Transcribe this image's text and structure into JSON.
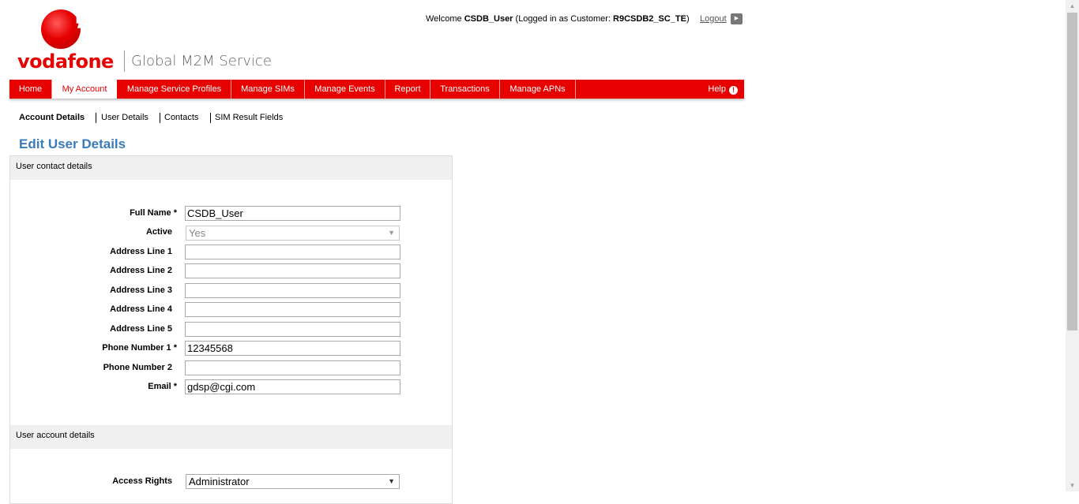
{
  "brand": {
    "logo_text": "vodafone",
    "subtitle": "Global M2M Service",
    "accent_color": "#e60000"
  },
  "session": {
    "welcome_prefix": "Welcome",
    "username": "CSDB_User",
    "logged_in_prefix": "(Logged in as Customer:",
    "customer": "R9CSDB2_SC_TE",
    "logged_in_suffix": ")",
    "logout_label": "Logout"
  },
  "nav": {
    "items": [
      {
        "label": "Home"
      },
      {
        "label": "My Account"
      },
      {
        "label": "Manage Service Profiles"
      },
      {
        "label": "Manage SIMs"
      },
      {
        "label": "Manage Events"
      },
      {
        "label": "Report"
      },
      {
        "label": "Transactions"
      },
      {
        "label": "Manage APNs"
      }
    ],
    "help_label": "Help"
  },
  "subnav": {
    "items": [
      {
        "label": "Account Details"
      },
      {
        "label": "User Details"
      },
      {
        "label": "Contacts"
      },
      {
        "label": "SIM Result Fields"
      }
    ]
  },
  "page_title": "Edit User Details",
  "contact_section": {
    "title": "User contact details",
    "fields": {
      "full_name": {
        "label": "Full Name",
        "required": "*",
        "value": "CSDB_User"
      },
      "active": {
        "label": "Active",
        "value": "Yes"
      },
      "address1": {
        "label": "Address Line 1",
        "value": ""
      },
      "address2": {
        "label": "Address Line 2",
        "value": ""
      },
      "address3": {
        "label": "Address Line 3",
        "value": ""
      },
      "address4": {
        "label": "Address Line 4",
        "value": ""
      },
      "address5": {
        "label": "Address Line 5",
        "value": ""
      },
      "phone1": {
        "label": "Phone Number 1",
        "required": "*",
        "value": "12345568"
      },
      "phone2": {
        "label": "Phone Number 2",
        "value": ""
      },
      "email": {
        "label": "Email",
        "required": "*",
        "value": "gdsp@cgi.com"
      }
    }
  },
  "account_section": {
    "title": "User account details",
    "fields": {
      "access_rights": {
        "label": "Access Rights",
        "value": "Administrator"
      }
    }
  }
}
